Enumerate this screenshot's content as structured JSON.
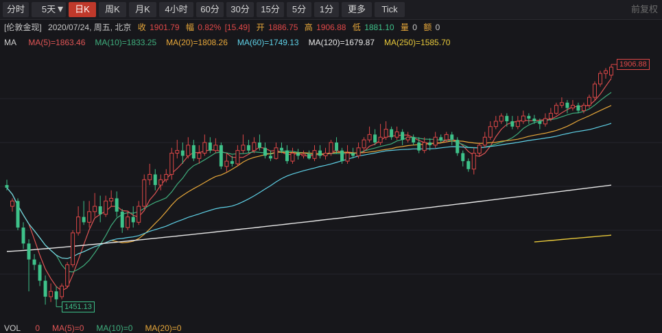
{
  "toolbar": {
    "tabs": [
      "分时",
      "5天",
      "日K",
      "周K",
      "月K",
      "4小时",
      "60分",
      "30分",
      "15分",
      "5分",
      "1分",
      "更多",
      "Tick"
    ],
    "active": "日K",
    "right_button": "前复权"
  },
  "info": {
    "symbol": "[伦敦金现]",
    "datetime": "2020/07/24, 周五, 北京",
    "close_label": "收",
    "close": "1901.79",
    "range_label": "幅",
    "range_pct": "0.82%",
    "range_abs": "[15.49]",
    "open_label": "开",
    "open": "1886.75",
    "high_label": "高",
    "high": "1906.88",
    "low_label": "低",
    "low": "1881.10",
    "vol_label": "量",
    "vol": "0",
    "amount_label": "额",
    "amount": "0"
  },
  "ma_legend": {
    "title": "MA",
    "items": [
      {
        "label": "MA(5)=1863.46",
        "color": "#e05555"
      },
      {
        "label": "MA(10)=1833.25",
        "color": "#3fae7d"
      },
      {
        "label": "MA(20)=1808.26",
        "color": "#e8a83a"
      },
      {
        "label": "MA(60)=1749.13",
        "color": "#5fd2e8"
      },
      {
        "label": "MA(120)=1679.87",
        "color": "#e8e8e8"
      },
      {
        "label": "MA(250)=1585.70",
        "color": "#e8c93a"
      }
    ]
  },
  "volume_legend": {
    "title": "VOL",
    "items": [
      {
        "label": "0",
        "color": "#e05555"
      },
      {
        "label": "MA(5)=0",
        "color": "#e05555"
      },
      {
        "label": "MA(10)=0",
        "color": "#3fae7d"
      },
      {
        "label": "MA(20)=0",
        "color": "#e8a83a"
      }
    ]
  },
  "colors": {
    "up": "#e04848",
    "down": "#3ec28a"
  },
  "chart_data": {
    "type": "candlestick",
    "high_marker": "1906.88",
    "low_marker": "1451.13",
    "ylim": [
      1430,
      1925
    ],
    "x_count": 111,
    "candles": [
      [
        1680,
        1675,
        1690,
        1670
      ],
      [
        1640,
        1650,
        1655,
        1630
      ],
      [
        1650,
        1600,
        1655,
        1595
      ],
      [
        1600,
        1570,
        1610,
        1560
      ],
      [
        1570,
        1540,
        1578,
        1480
      ],
      [
        1540,
        1530,
        1550,
        1520
      ],
      [
        1530,
        1500,
        1535,
        1490
      ],
      [
        1500,
        1470,
        1510,
        1455
      ],
      [
        1470,
        1480,
        1495,
        1460
      ],
      [
        1480,
        1465,
        1490,
        1451
      ],
      [
        1470,
        1490,
        1495,
        1465
      ],
      [
        1490,
        1530,
        1535,
        1488
      ],
      [
        1530,
        1590,
        1595,
        1525
      ],
      [
        1590,
        1620,
        1640,
        1585
      ],
      [
        1620,
        1610,
        1650,
        1605
      ],
      [
        1610,
        1630,
        1650,
        1600
      ],
      [
        1630,
        1640,
        1665,
        1620
      ],
      [
        1640,
        1625,
        1660,
        1610
      ],
      [
        1625,
        1650,
        1660,
        1620
      ],
      [
        1650,
        1655,
        1670,
        1640
      ],
      [
        1655,
        1630,
        1668,
        1620
      ],
      [
        1630,
        1600,
        1635,
        1590
      ],
      [
        1600,
        1620,
        1630,
        1595
      ],
      [
        1620,
        1610,
        1640,
        1600
      ],
      [
        1610,
        1640,
        1650,
        1605
      ],
      [
        1640,
        1690,
        1700,
        1635
      ],
      [
        1690,
        1700,
        1720,
        1680
      ],
      [
        1700,
        1680,
        1710,
        1670
      ],
      [
        1680,
        1690,
        1700,
        1670
      ],
      [
        1690,
        1700,
        1710,
        1685
      ],
      [
        1700,
        1740,
        1750,
        1690
      ],
      [
        1740,
        1745,
        1765,
        1730
      ],
      [
        1745,
        1735,
        1760,
        1720
      ],
      [
        1735,
        1755,
        1770,
        1730
      ],
      [
        1755,
        1730,
        1765,
        1725
      ],
      [
        1730,
        1740,
        1755,
        1720
      ],
      [
        1740,
        1760,
        1775,
        1735
      ],
      [
        1760,
        1745,
        1770,
        1740
      ],
      [
        1745,
        1755,
        1768,
        1740
      ],
      [
        1755,
        1715,
        1760,
        1710
      ],
      [
        1715,
        1725,
        1740,
        1705
      ],
      [
        1725,
        1720,
        1735,
        1715
      ],
      [
        1720,
        1745,
        1755,
        1715
      ],
      [
        1745,
        1755,
        1775,
        1740
      ],
      [
        1755,
        1745,
        1765,
        1740
      ],
      [
        1745,
        1760,
        1770,
        1740
      ],
      [
        1760,
        1750,
        1775,
        1745
      ],
      [
        1750,
        1735,
        1760,
        1730
      ],
      [
        1735,
        1730,
        1745,
        1725
      ],
      [
        1730,
        1750,
        1760,
        1728
      ],
      [
        1750,
        1745,
        1760,
        1740
      ],
      [
        1745,
        1725,
        1755,
        1720
      ],
      [
        1725,
        1740,
        1750,
        1720
      ],
      [
        1740,
        1735,
        1748,
        1728
      ],
      [
        1735,
        1738,
        1745,
        1730
      ],
      [
        1738,
        1730,
        1745,
        1728
      ],
      [
        1730,
        1745,
        1755,
        1725
      ],
      [
        1745,
        1735,
        1755,
        1730
      ],
      [
        1735,
        1740,
        1750,
        1728
      ],
      [
        1740,
        1760,
        1765,
        1735
      ],
      [
        1760,
        1745,
        1770,
        1740
      ],
      [
        1745,
        1725,
        1750,
        1720
      ],
      [
        1725,
        1740,
        1755,
        1720
      ],
      [
        1740,
        1735,
        1750,
        1730
      ],
      [
        1735,
        1750,
        1760,
        1730
      ],
      [
        1750,
        1765,
        1770,
        1740
      ],
      [
        1765,
        1775,
        1790,
        1760
      ],
      [
        1775,
        1760,
        1785,
        1755
      ],
      [
        1760,
        1770,
        1795,
        1755
      ],
      [
        1770,
        1785,
        1800,
        1765
      ],
      [
        1785,
        1770,
        1790,
        1765
      ],
      [
        1770,
        1780,
        1790,
        1765
      ],
      [
        1780,
        1765,
        1785,
        1755
      ],
      [
        1765,
        1770,
        1780,
        1760
      ],
      [
        1770,
        1760,
        1775,
        1755
      ],
      [
        1760,
        1745,
        1770,
        1740
      ],
      [
        1745,
        1760,
        1770,
        1740
      ],
      [
        1760,
        1755,
        1768,
        1745
      ],
      [
        1755,
        1770,
        1780,
        1750
      ],
      [
        1770,
        1765,
        1775,
        1760
      ],
      [
        1765,
        1775,
        1780,
        1760
      ],
      [
        1775,
        1765,
        1780,
        1755
      ],
      [
        1765,
        1740,
        1770,
        1735
      ],
      [
        1740,
        1725,
        1745,
        1715
      ],
      [
        1725,
        1710,
        1730,
        1705
      ],
      [
        1710,
        1740,
        1750,
        1700
      ],
      [
        1740,
        1755,
        1760,
        1735
      ],
      [
        1755,
        1770,
        1780,
        1750
      ],
      [
        1770,
        1790,
        1800,
        1765
      ],
      [
        1790,
        1800,
        1810,
        1785
      ],
      [
        1800,
        1810,
        1815,
        1795
      ],
      [
        1810,
        1800,
        1815,
        1790
      ],
      [
        1800,
        1790,
        1810,
        1785
      ],
      [
        1790,
        1800,
        1810,
        1785
      ],
      [
        1800,
        1810,
        1820,
        1795
      ],
      [
        1810,
        1805,
        1815,
        1795
      ],
      [
        1805,
        1800,
        1812,
        1795
      ],
      [
        1800,
        1795,
        1805,
        1785
      ],
      [
        1795,
        1805,
        1815,
        1790
      ],
      [
        1805,
        1815,
        1825,
        1800
      ],
      [
        1815,
        1830,
        1835,
        1812
      ],
      [
        1830,
        1835,
        1845,
        1825
      ],
      [
        1835,
        1825,
        1840,
        1815
      ],
      [
        1825,
        1830,
        1840,
        1820
      ],
      [
        1830,
        1820,
        1835,
        1815
      ],
      [
        1820,
        1830,
        1835,
        1815
      ],
      [
        1830,
        1845,
        1850,
        1825
      ],
      [
        1845,
        1870,
        1875,
        1840
      ],
      [
        1870,
        1890,
        1895,
        1865
      ],
      [
        1890,
        1895,
        1900,
        1880
      ],
      [
        1886.75,
        1901.79,
        1906.88,
        1881.1
      ]
    ]
  }
}
